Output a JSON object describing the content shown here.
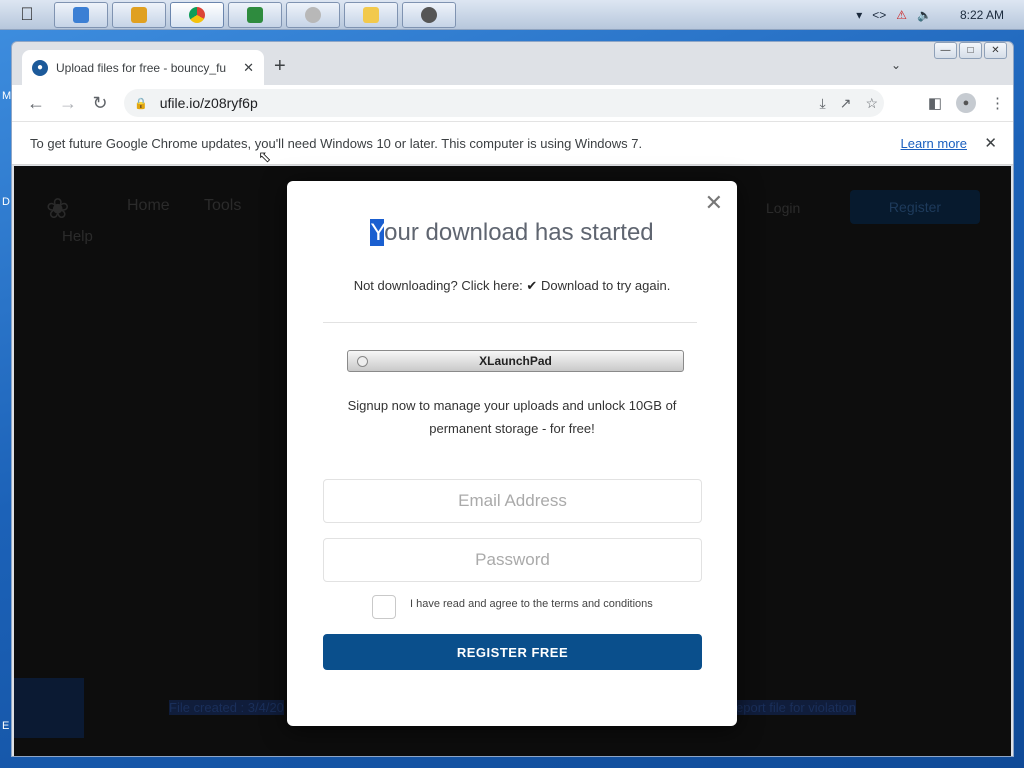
{
  "taskbar": {
    "apps": [
      {
        "name": "finder-app",
        "color": "#3b7fd4"
      },
      {
        "name": "media-app",
        "color": "#e0a020"
      },
      {
        "name": "chrome-app",
        "color": "#db4437"
      },
      {
        "name": "cpuz-app",
        "color": "#2e8b3e"
      },
      {
        "name": "xlaunchpad-app",
        "color": "#8a8a8a"
      },
      {
        "name": "notes-app",
        "color": "#f2c94c"
      },
      {
        "name": "disc-app",
        "color": "#555555"
      }
    ],
    "clock": "8:22 AM"
  },
  "browser": {
    "tab_title": "Upload files for free - bouncy_fu",
    "url": "ufile.io/z08ryf6p"
  },
  "infobar": {
    "message": "To get future Google Chrome updates, you'll need Windows 10 or later. This computer is using Windows 7.",
    "link": "Learn more"
  },
  "site": {
    "nav": [
      "Home",
      "Tools",
      "Login",
      "Register"
    ],
    "help": "Help",
    "file_created": "File created : 3/4/20",
    "report": "eport file for violation"
  },
  "modal": {
    "title_first": "Y",
    "title_rest": "our download has started",
    "sub_prefix": "Not downloading? Click here:",
    "sub_link": "Download to try again.",
    "xlaunchpad": "XLaunchPad",
    "desc": "Signup now to manage your uploads and unlock 10GB of permanent storage - for free!",
    "email_placeholder": "Email Address",
    "password_placeholder": "Password",
    "terms": "I have read and agree to the terms and conditions",
    "register": "REGISTER FREE"
  },
  "colors": {
    "accent": "#0a4f8c",
    "selection": "#1a5fd0"
  }
}
